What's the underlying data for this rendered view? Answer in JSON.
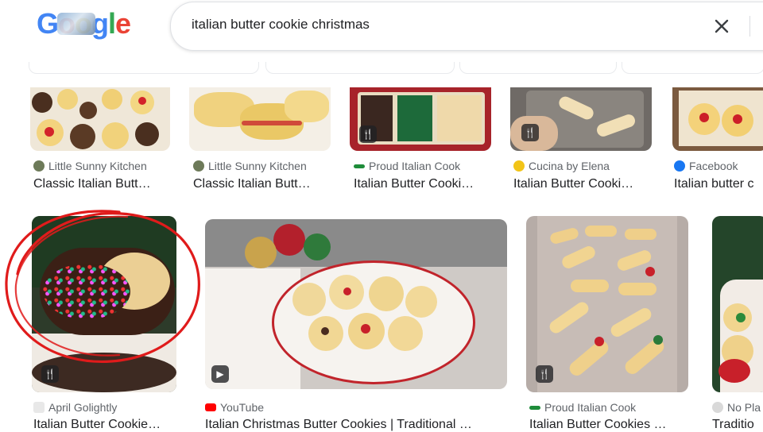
{
  "app": {
    "logo_letters": [
      "G",
      "o",
      "o",
      "g",
      "l",
      "e"
    ]
  },
  "search": {
    "query": "italian butter cookie christmas"
  },
  "icons": {
    "clear": "close-icon",
    "voice": "microphone-icon",
    "recipe": "utensils-icon",
    "video": "play-icon"
  },
  "row1": [
    {
      "source": "Little Sunny Kitchen",
      "title": "Classic Italian Butt…"
    },
    {
      "source": "Little Sunny Kitchen",
      "title": "Classic Italian Butt…"
    },
    {
      "source": "Proud Italian Cook",
      "title": "Italian Butter Cooki…"
    },
    {
      "source": "Cucina by Elena",
      "title": "Italian Butter Cooki…"
    },
    {
      "source": "Facebook",
      "title": "Italian butter c"
    }
  ],
  "row2": [
    {
      "source": "April Golightly",
      "title": "Italian Butter Cookie…"
    },
    {
      "source": "YouTube",
      "title": "Italian Christmas Butter Cookies | Traditional …"
    },
    {
      "source": "Proud Italian Cook",
      "title": "Italian Butter Cookies …"
    },
    {
      "source": "No Pla",
      "title": "Traditio"
    }
  ],
  "colors": {
    "annotation_circle": "#e01b1b",
    "youtube": "#ff0000",
    "facebook": "#1877f2"
  }
}
